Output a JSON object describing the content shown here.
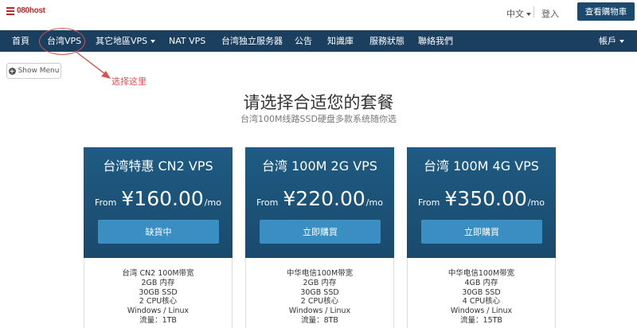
{
  "header": {
    "logo_text": "080host",
    "language": "中文",
    "login": "登入",
    "cart_button": "查看購物車"
  },
  "nav": {
    "items": [
      {
        "label": "首頁"
      },
      {
        "label": "台湾VPS"
      },
      {
        "label": "其它地區VPS"
      },
      {
        "label": "NAT VPS"
      },
      {
        "label": "台湾独立服务器"
      },
      {
        "label": "公告"
      },
      {
        "label": "知識庫"
      },
      {
        "label": "服務狀態"
      },
      {
        "label": "聯絡我們"
      }
    ],
    "account": "帳戶"
  },
  "annotation": {
    "text": "选择这里",
    "color": "#d9534f"
  },
  "show_menu": {
    "label": "Show Menu"
  },
  "page": {
    "title": "请选择合适您的套餐",
    "subtitle": "台湾100M线路SSD硬盘多款系统随你选"
  },
  "plans": [
    {
      "name": "台湾特惠 CN2 VPS",
      "from": "From",
      "price": "¥160.00",
      "per": "/mo",
      "button": "缺貨中",
      "features": [
        "台湾 CN2 100M带宽",
        "2GB 内存",
        "30GB SSD",
        "2 CPU核心",
        "Windows / Linux",
        "流量：1TB"
      ]
    },
    {
      "name": "台湾 100M 2G VPS",
      "from": "From",
      "price": "¥220.00",
      "per": "/mo",
      "button": "立即購買",
      "features": [
        "中华电信100M带宽",
        "2GB 内存",
        "30GB SSD",
        "2 CPU核心",
        "Windows / Linux",
        "流量：8TB"
      ]
    },
    {
      "name": "台湾 100M 4G VPS",
      "from": "From",
      "price": "¥350.00",
      "per": "/mo",
      "button": "立即購買",
      "features": [
        "中华电信100M带宽",
        "4GB 内存",
        "30GB SSD",
        "4 CPU核心",
        "Windows / Linux",
        "流量：15TB"
      ]
    }
  ],
  "colors": {
    "nav_bg": "#1b3f5f",
    "card_header": "#1e5b83",
    "button_blue": "#3a8ec2",
    "cart_button": "#1c4a6e"
  }
}
